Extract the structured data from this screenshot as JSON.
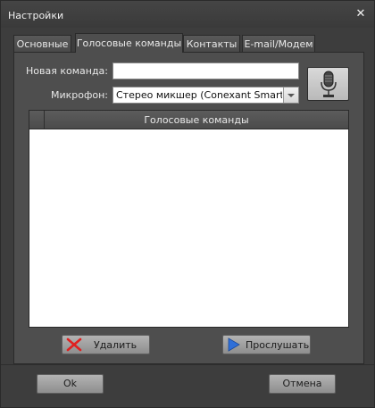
{
  "window": {
    "title": "Настройки"
  },
  "tabs": [
    {
      "label": "Основные",
      "active": false
    },
    {
      "label": "Голосовые команды",
      "active": true
    },
    {
      "label": "Контакты",
      "active": false
    },
    {
      "label": "E-mail/Модем",
      "active": false
    }
  ],
  "form": {
    "new_command_label": "Новая команда:",
    "new_command_value": "",
    "microphone_label": "Микрофон:",
    "microphone_value": "Стерео микшер (Conexant SmartA..."
  },
  "list": {
    "column_header": "Голосовые команды",
    "rows": []
  },
  "actions": {
    "delete_label": "Удалить",
    "listen_label": "Прослушать"
  },
  "footer": {
    "ok_label": "Ok",
    "cancel_label": "Отмена"
  },
  "icons": {
    "close": "close-icon",
    "microphone": "microphone-icon",
    "delete": "red-x-icon",
    "listen": "play-icon"
  },
  "colors": {
    "background": "#3d3d3d",
    "panel": "#4e4e4e",
    "delete_icon": "#e02020",
    "play_icon": "#2f6fd8"
  }
}
